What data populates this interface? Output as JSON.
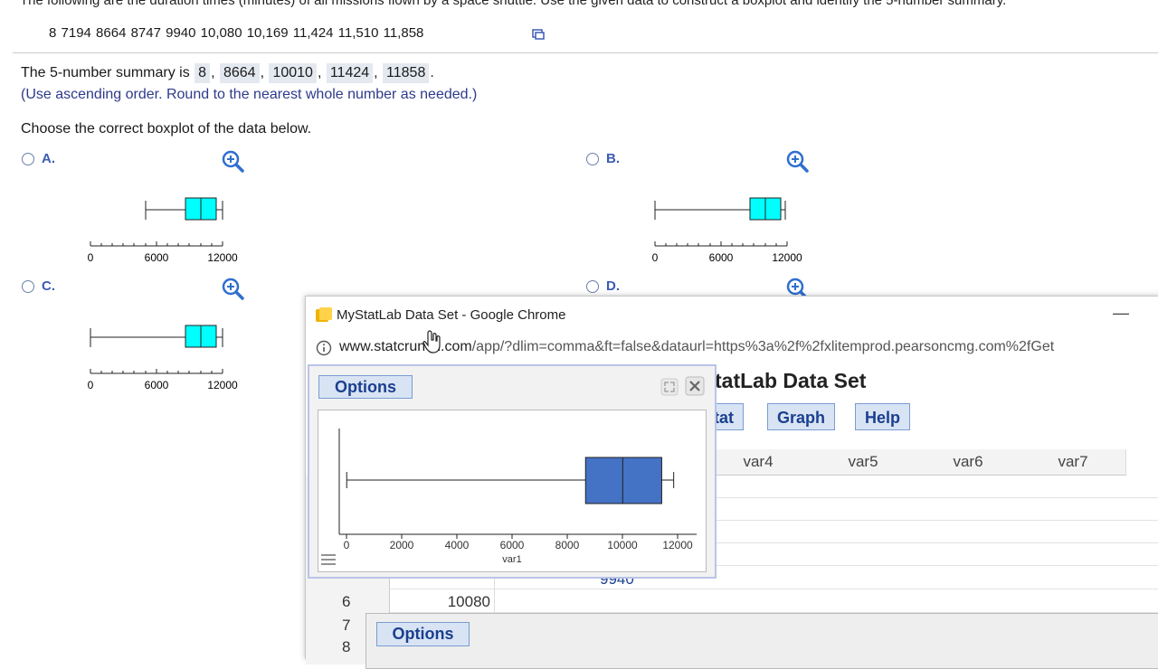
{
  "question": {
    "intro": "The following are the duration times (minutes) of all missions flown by a space shuttle. Use the given data to construct a boxplot and identify the 5-number summary.",
    "data_values": "8  7194  8664  8747  9940  10,080  10,169  11,424  11,510  11,858",
    "summary_prefix": "The 5-number summary is",
    "answers": [
      "8",
      "8664",
      "10010",
      "11424",
      "11858"
    ],
    "hint": "(Use ascending order. Round to the nearest whole number as needed.)",
    "choose": "Choose the correct boxplot of the data below."
  },
  "options": [
    {
      "label": "A.",
      "ticks": [
        "0",
        "6000",
        "12000"
      ]
    },
    {
      "label": "B.",
      "ticks": [
        "0",
        "6000",
        "12000"
      ]
    },
    {
      "label": "C.",
      "ticks": [
        "0",
        "6000",
        "12000"
      ]
    },
    {
      "label": "D."
    }
  ],
  "popup": {
    "title": "MyStatLab Data Set - Google Chrome",
    "url_host": "www.statcrunch.com",
    "url_path": "/app/?dlim=comma&ft=false&dataurl=https%3a%2f%2fxlitemprod.pearsoncmg.com%2fGet",
    "app_title": "tatLab Data Set",
    "menu": [
      "tat",
      "Graph",
      "Help"
    ],
    "columns": [
      "var4",
      "var5",
      "var6",
      "var7"
    ],
    "rows": [
      {
        "index": "6",
        "value": "10080"
      },
      {
        "index": "7",
        "value": ""
      },
      {
        "index": "8",
        "value": ""
      }
    ],
    "partial_value": "9940"
  },
  "graph_window": {
    "options_label": "Options",
    "chart_data": {
      "type": "boxplot",
      "xlabel": "var1",
      "xlim": [
        0,
        12000
      ],
      "ticks": [
        "0",
        "2000",
        "4000",
        "6000",
        "8000",
        "10000",
        "12000"
      ],
      "min": 8,
      "q1": 8664,
      "median": 10010,
      "q3": 11424,
      "max": 11858,
      "box_color": "#4472c4"
    }
  },
  "lower_window": {
    "options_label": "Options"
  }
}
